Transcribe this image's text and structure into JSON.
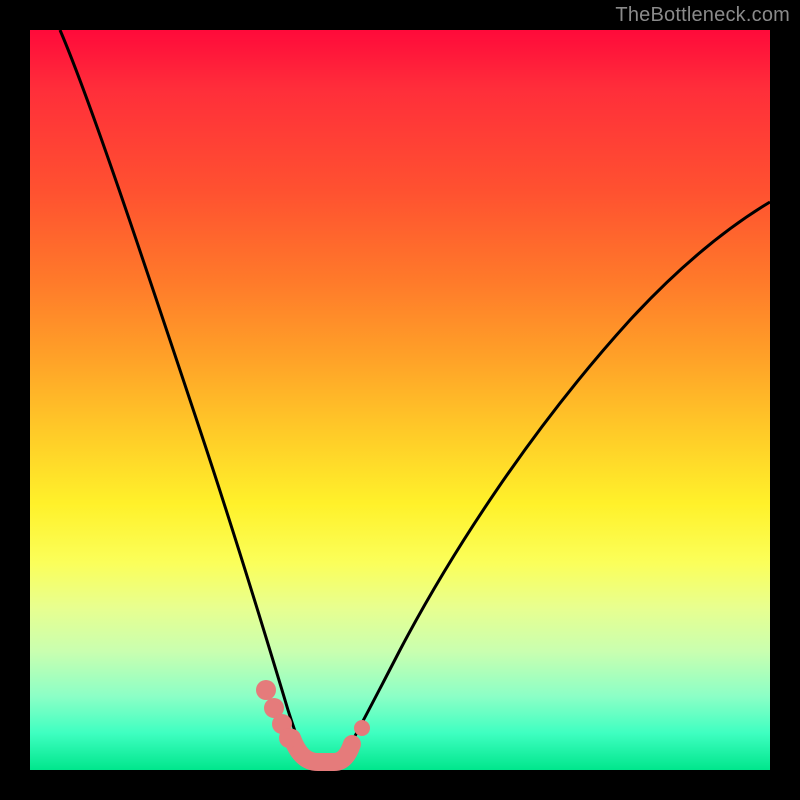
{
  "watermark": "TheBottleneck.com",
  "colors": {
    "frame": "#000000",
    "curve": "#000000",
    "marker_fill": "#e57b7b",
    "marker_stroke": "#d86a6a"
  },
  "chart_data": {
    "type": "line",
    "title": "",
    "xlabel": "",
    "ylabel": "",
    "xlim": [
      0,
      100
    ],
    "ylim": [
      0,
      100
    ],
    "grid": false,
    "legend": false,
    "series": [
      {
        "name": "left-curve",
        "x": [
          4,
          6,
          8,
          10,
          12,
          14,
          16,
          18,
          20,
          22,
          24,
          26,
          28,
          30,
          32,
          33,
          34,
          35,
          36,
          37
        ],
        "y": [
          100,
          94,
          88,
          82,
          76,
          70,
          63,
          56,
          50,
          43,
          36,
          30,
          23,
          17,
          11,
          8,
          6,
          4,
          2.5,
          1.5
        ]
      },
      {
        "name": "right-curve",
        "x": [
          42,
          43,
          44,
          45,
          47,
          50,
          54,
          58,
          62,
          66,
          70,
          74,
          78,
          82,
          86,
          90,
          94,
          98,
          100
        ],
        "y": [
          1.5,
          2.5,
          4,
          6,
          9,
          14,
          21,
          28,
          34,
          40,
          46,
          51,
          56,
          61,
          65,
          69,
          72,
          75,
          77
        ]
      }
    ],
    "markers": [
      {
        "name": "left-cluster-1",
        "x": 32.0,
        "y": 11.0
      },
      {
        "name": "left-cluster-2",
        "x": 33.0,
        "y": 8.5
      },
      {
        "name": "left-cluster-3",
        "x": 34.0,
        "y": 6.0
      },
      {
        "name": "left-cluster-4",
        "x": 35.0,
        "y": 4.0
      },
      {
        "name": "right-small",
        "x": 44.5,
        "y": 5.0
      },
      {
        "name": "bar-start",
        "x": 36.5,
        "y": 1.8
      },
      {
        "name": "bar-end",
        "x": 42.0,
        "y": 1.8
      }
    ]
  }
}
